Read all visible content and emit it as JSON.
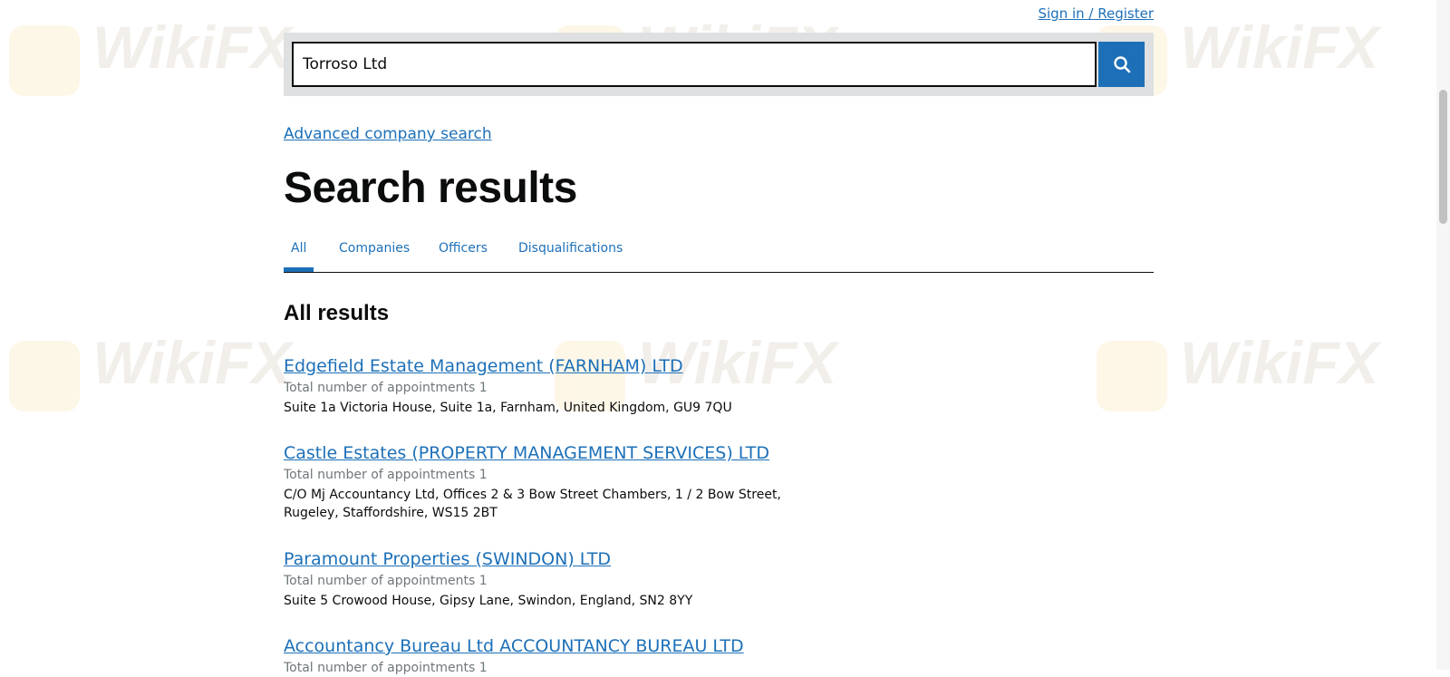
{
  "header": {
    "signin_label": "Sign in / Register"
  },
  "search": {
    "value": "Torroso Ltd",
    "button_icon": "search-icon"
  },
  "advanced_search_label": "Advanced company search",
  "page_title": "Search results",
  "tabs": [
    {
      "label": "All",
      "active": true
    },
    {
      "label": "Companies",
      "active": false
    },
    {
      "label": "Officers",
      "active": false
    },
    {
      "label": "Disqualifications",
      "active": false
    }
  ],
  "section_heading": "All results",
  "results": [
    {
      "title": "Edgefield Estate Management (FARNHAM) LTD",
      "appointments": "Total number of appointments 1",
      "address": "Suite 1a Victoria House, Suite 1a, Farnham, United Kingdom, GU9 7QU"
    },
    {
      "title": "Castle Estates (PROPERTY MANAGEMENT SERVICES) LTD",
      "appointments": "Total number of appointments 1",
      "address": "C/O Mj Accountancy Ltd, Offices 2 & 3 Bow Street Chambers, 1 / 2 Bow Street, Rugeley, Staffordshire, WS15 2BT"
    },
    {
      "title": "Paramount Properties (SWINDON) LTD",
      "appointments": "Total number of appointments 1",
      "address": "Suite 5 Crowood House, Gipsy Lane, Swindon, England, SN2 8YY"
    },
    {
      "title": "Accountancy Bureau Ltd ACCOUNTANCY BUREAU LTD",
      "appointments": "Total number of appointments 1"
    }
  ],
  "watermark_text": "WikiFX",
  "colors": {
    "link": "#1d70b8",
    "text": "#0b0c0c",
    "secondary_text": "#6f777b",
    "search_panel": "#dee0e2"
  }
}
